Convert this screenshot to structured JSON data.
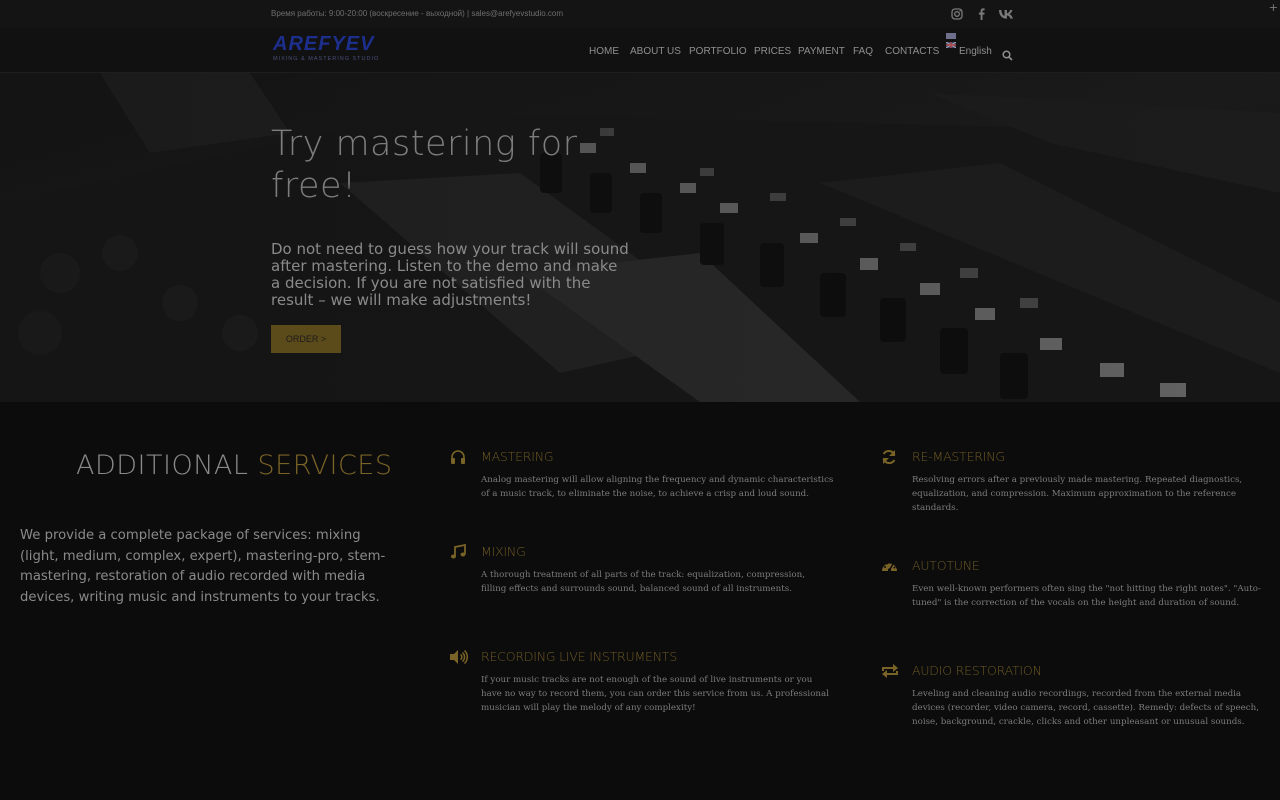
{
  "topbar": {
    "info": "Время работы: 9:00-20:00 (воскресение - выходной)  |  sales@arefyevstudio.com",
    "social": [
      "instagram-icon",
      "facebook-icon",
      "vk-icon"
    ],
    "corner": "+"
  },
  "header": {
    "logo_mark": "AREFYEV",
    "logo_sub": "MIXING & MASTERING STUDIO",
    "nav": [
      "HOME",
      "ABOUT US",
      "PORTFOLIO",
      "PRICES",
      "PAYMENT",
      "FAQ",
      "CONTACTS"
    ],
    "language": "English"
  },
  "hero": {
    "title": "Try mastering for free!",
    "text": "Do not need to guess how your track will sound after mastering. Listen to the demo and make a decision. If you are not satisfied with the result – we will make adjustments!",
    "button": "ORDER >"
  },
  "services": {
    "title_part1": "ADDITIONAL",
    "title_part2": "SERVICES",
    "description": "We provide a complete package of services: mixing (light, medium, complex, expert), mastering-pro, stem-mastering, restoration of audio recorded with media devices, writing music and instruments to your tracks.",
    "items": [
      {
        "icon": "headphones-icon",
        "title": "MASTERING",
        "text": "Analog mastering will allow aligning the frequency and dynamic characteristics of a music track, to eliminate the noise, to achieve a crisp and loud sound."
      },
      {
        "icon": "refresh-icon",
        "title": "RE-MASTERING",
        "text": "Resolving errors after a previously made mastering. Repeated diagnostics, equalization, and compression. Maximum approximation to the reference standards."
      },
      {
        "icon": "music-note-icon",
        "title": "MIXING",
        "text": "A thorough treatment of all parts of the track: equalization, compression, filling effects and surrounds sound, balanced sound of all instruments."
      },
      {
        "icon": "dashboard-icon",
        "title": "AUTOTUNE",
        "text": "Even well-known performers often sing the \"not hitting the right notes\". \"Auto-tuned\" is the correction of the vocals on the height and duration of sound."
      },
      {
        "icon": "speaker-icon",
        "title": "RECORDING LIVE INSTRUMENTS",
        "text": "If your music tracks are not enough of the sound of live instruments or you have no way to record them, you can order this service from us. A professional musician will play the melody of any complexity!"
      },
      {
        "icon": "repeat-icon",
        "title": "AUDIO RESTORATION",
        "text": "Leveling and cleaning audio recordings, recorded from the external media devices (recorder, video camera, record, cassette). Remedy: defects of speech, noise, background, crackle, clicks and other unpleasant or unusual sounds."
      }
    ]
  },
  "colors": {
    "accent": "#7a6326",
    "background": "#0c0c0d",
    "button": "#5c4b1a"
  }
}
